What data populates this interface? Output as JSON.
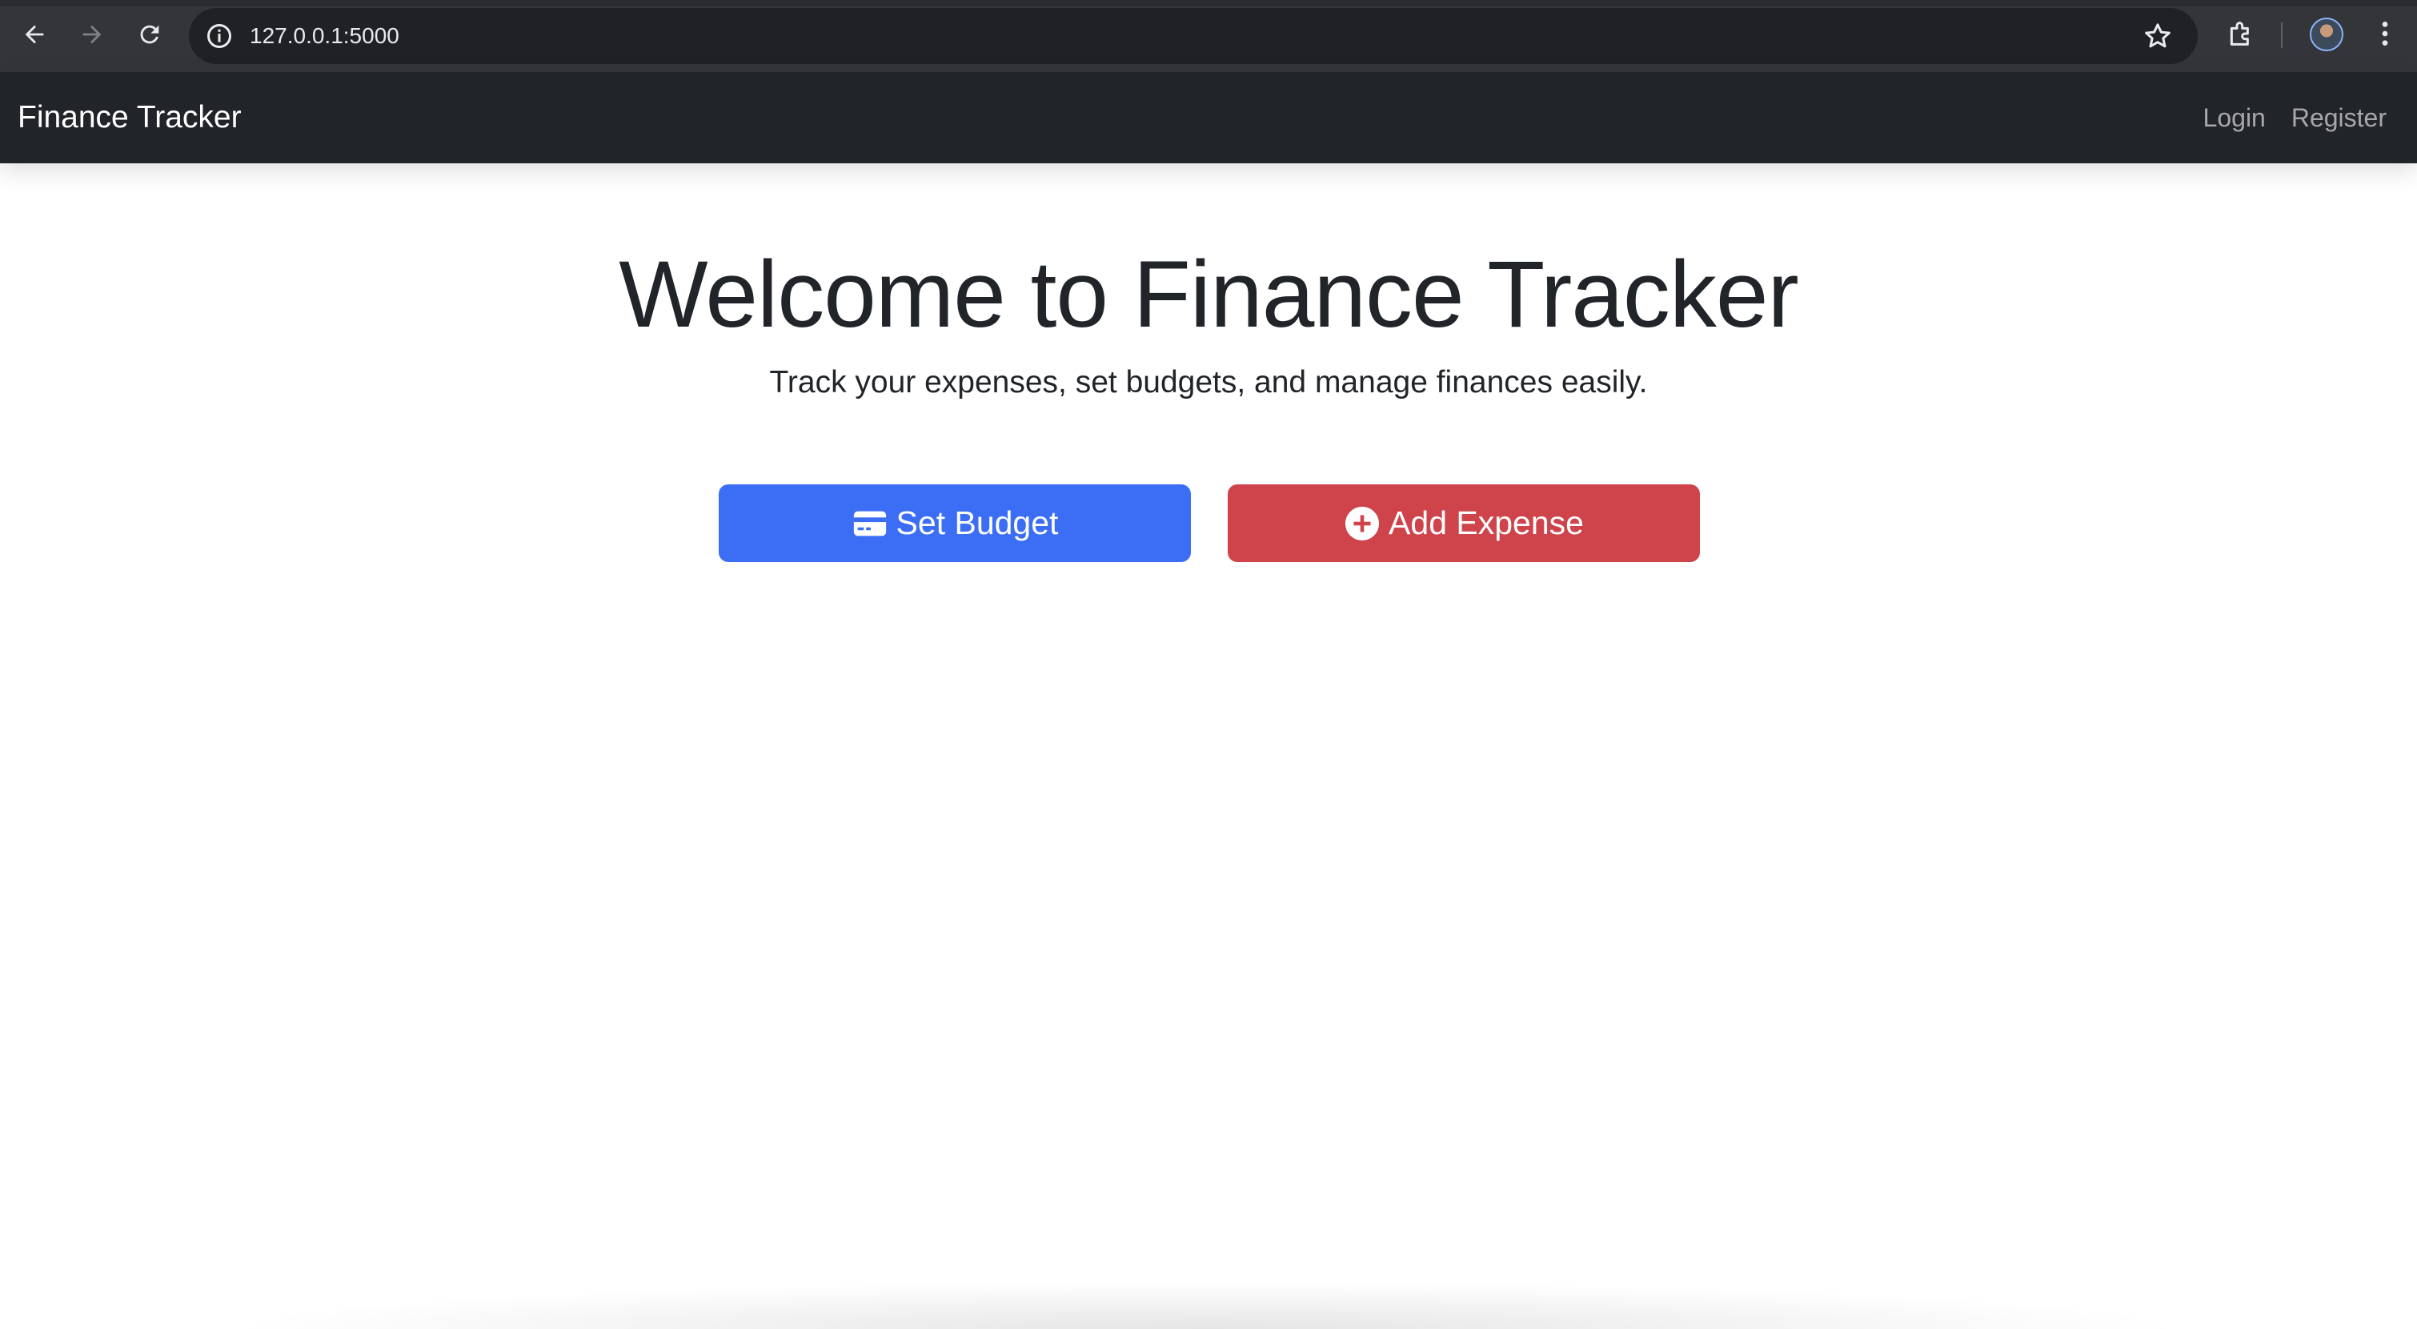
{
  "browser": {
    "url": "127.0.0.1:5000",
    "icons": [
      "back-arrow-icon",
      "forward-arrow-icon",
      "reload-icon",
      "info-icon",
      "bookmark-star-icon",
      "extensions-icon",
      "profile-avatar",
      "more-vert-icon"
    ]
  },
  "navbar": {
    "brand": "Finance Tracker",
    "links": [
      {
        "label": "Login"
      },
      {
        "label": "Register"
      }
    ]
  },
  "hero": {
    "title": "Welcome to Finance Tracker",
    "subtitle": "Track your expenses, set budgets, and manage finances easily."
  },
  "actions": {
    "set_budget": {
      "label": "Set Budget",
      "icon": "credit-card-icon",
      "color": "#3b6ef5"
    },
    "add_expense": {
      "label": "Add Expense",
      "icon": "plus-circle-icon",
      "color": "#cf434b"
    }
  },
  "colors": {
    "navbar_bg": "#212529",
    "chrome_bg": "#333539"
  }
}
